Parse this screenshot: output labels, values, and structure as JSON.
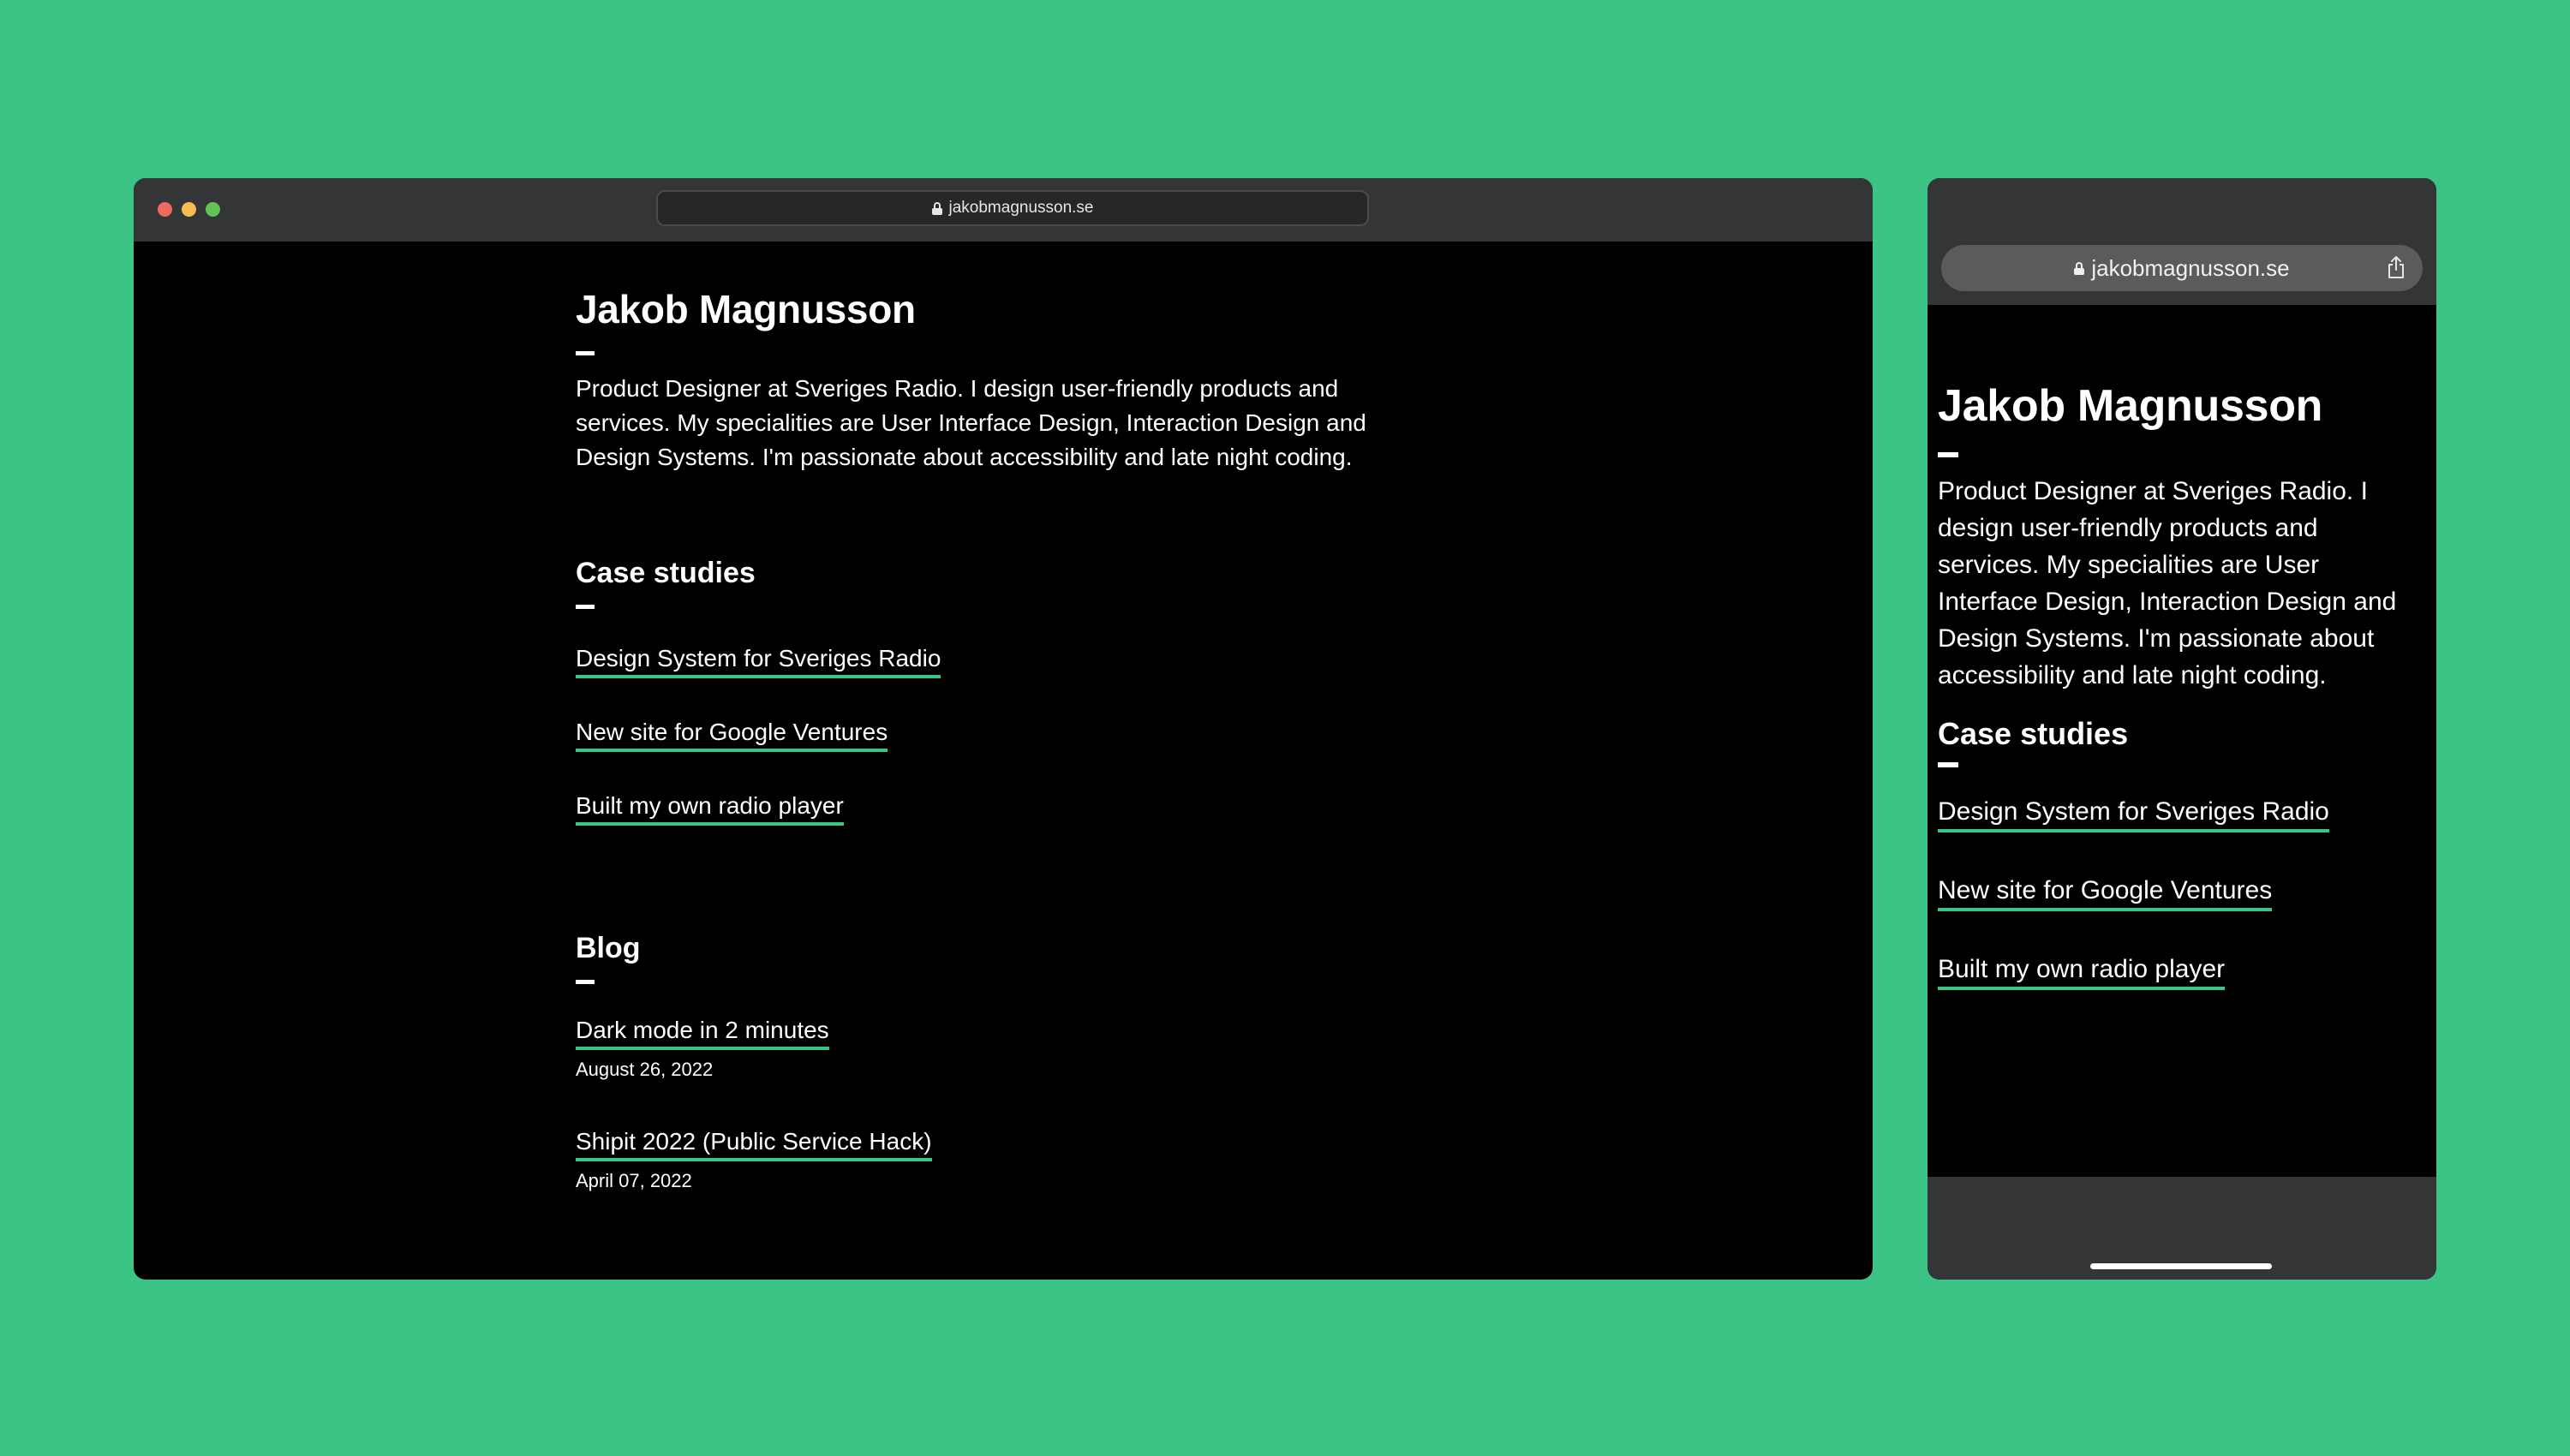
{
  "url": "jakobmagnusson.se",
  "profile": {
    "name": "Jakob Magnusson",
    "bio": "Product Designer at Sveriges Radio. I design user-friendly products and services. My specialities are User Interface Design, Interaction Design and Design Systems. I'm passionate about accessibility and late night coding."
  },
  "case_studies": {
    "heading": "Case studies",
    "items": [
      {
        "label": "Design System for Sveriges Radio"
      },
      {
        "label": "New site for Google Ventures"
      },
      {
        "label": "Built my own radio player"
      }
    ]
  },
  "blog": {
    "heading": "Blog",
    "posts": [
      {
        "title": "Dark mode in 2 minutes",
        "date": "August 26, 2022"
      },
      {
        "title": "Shipit 2022 (Public Service Hack)",
        "date": "April 07, 2022"
      }
    ]
  },
  "colors": {
    "background": "#3cc487",
    "accent_underline": "#3cc487",
    "page_bg": "#000000",
    "chrome": "#343536"
  }
}
